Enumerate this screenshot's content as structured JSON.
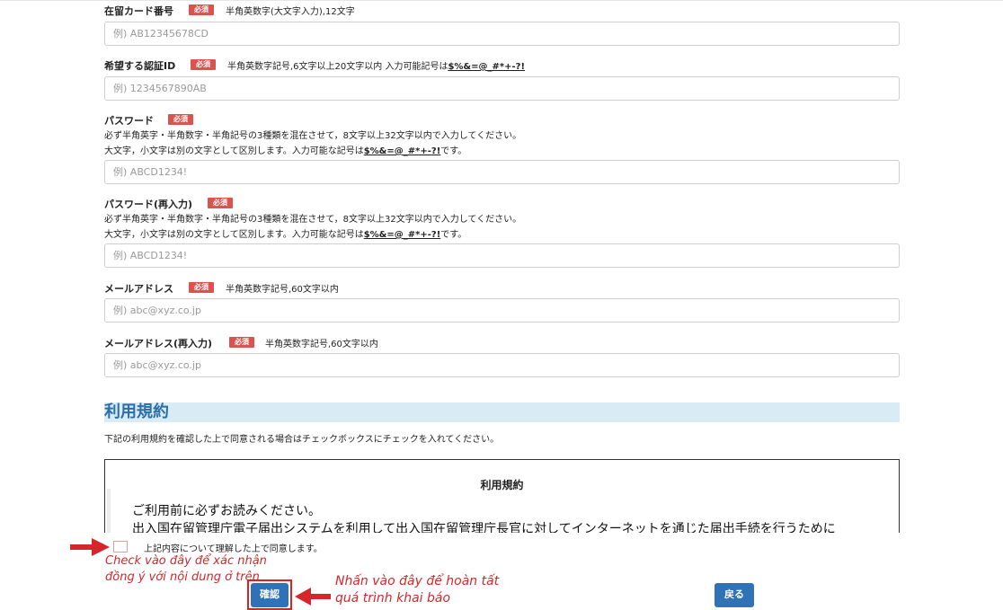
{
  "form": {
    "required_label": "必須",
    "fields": [
      {
        "label": "在留カード番号",
        "hint": "半角英数字(大文字入力),12文字",
        "placeholder": "例) AB12345678CD"
      },
      {
        "label": "希望する認証ID",
        "hint_prefix": "半角英数字記号,6文字以上20文字以内 入力可能記号は",
        "hint_symbols": "$%&=@_#*+-?!",
        "placeholder": "例) 1234567890AB"
      },
      {
        "label": "パスワード",
        "desc1": "必ず半角英字・半角数字・半角記号の3種類を混在させて，8文字以上32文字以内で入力してください。",
        "desc2_prefix": "大文字，小文字は別の文字として区別します。入力可能な記号は",
        "desc2_symbols": "$%&=@_#*+-?!",
        "desc2_suffix": "です。",
        "placeholder": "例) ABCD1234!"
      },
      {
        "label": "パスワード(再入力)",
        "desc1": "必ず半角英字・半角数字・半角記号の3種類を混在させて，8文字以上32文字以内で入力してください。",
        "desc2_prefix": "大文字，小文字は別の文字として区別します。入力可能な記号は",
        "desc2_symbols": "$%&=@_#*+-?!",
        "desc2_suffix": "です。",
        "placeholder": "例) ABCD1234!"
      },
      {
        "label": "メールアドレス",
        "hint": "半角英数字記号,60文字以内",
        "placeholder": "例) abc@xyz.co.jp"
      },
      {
        "label": "メールアドレス(再入力)",
        "hint": "半角英数字記号,60文字以内",
        "placeholder": "例) abc@xyz.co.jp"
      }
    ]
  },
  "terms": {
    "section_title": "利用規約",
    "section_desc": "下記の利用規約を確認した上で同意される場合はチェックボックスにチェックを入れてください。",
    "box_title": "利用規約",
    "line1": "ご利用前に必ずお読みください。",
    "line2": "出入国在留管理庁電子届出システムを利用して出入国在留管理庁長官に対してインターネットを通じた届出手続を行うために",
    "agree_label": "上記内容について理解した上で同意します。"
  },
  "annotations": {
    "check_note_line1": "Check vào đây để xác nhận",
    "check_note_line2": "đồng ý với nội dung ở trên",
    "confirm_note_line1": "Nhấn vào đây để hoàn tất",
    "confirm_note_line2": "quá trình khai báo",
    "color": "#d7262b"
  },
  "buttons": {
    "confirm": "確認",
    "back": "戻る"
  },
  "colors": {
    "required_badge": "#d9534f",
    "button": "#2f72b5",
    "section_bg": "#d9ebf5",
    "section_title": "#2a6fa8"
  }
}
